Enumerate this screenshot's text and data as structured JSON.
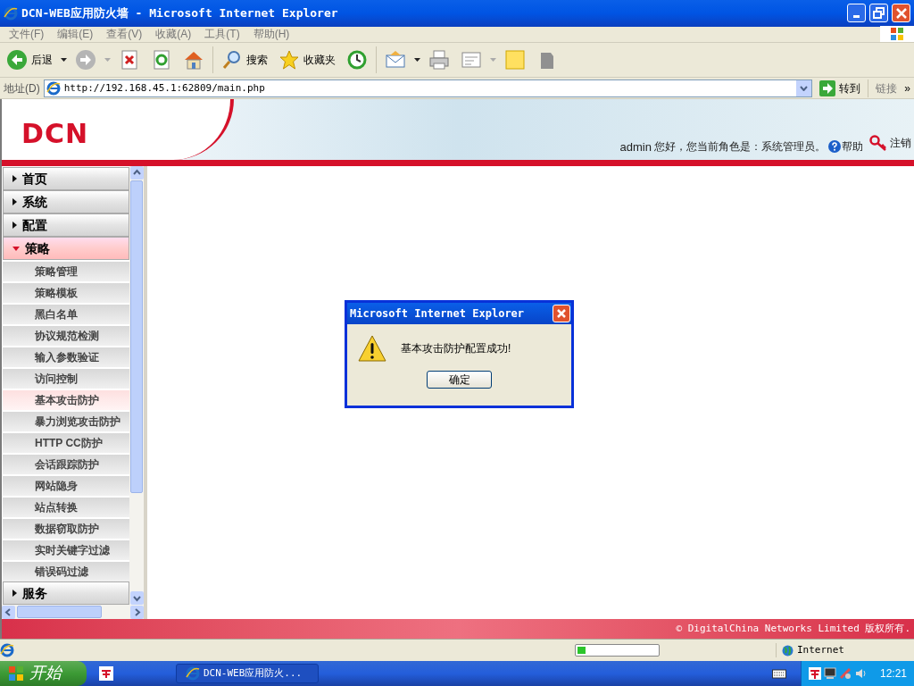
{
  "window": {
    "title": "DCN-WEB应用防火墙 - Microsoft Internet Explorer"
  },
  "menu_bar": [
    "文件(F)",
    "编辑(E)",
    "查看(V)",
    "收藏(A)",
    "工具(T)",
    "帮助(H)"
  ],
  "toolbar": [
    {
      "kind": "back",
      "label": "后退"
    },
    {
      "kind": "forward"
    },
    {
      "kind": "stop"
    },
    {
      "kind": "refresh"
    },
    {
      "kind": "home"
    },
    {
      "kind": "search",
      "label": "搜索"
    },
    {
      "kind": "favorites",
      "label": "收藏夹"
    },
    {
      "kind": "history"
    },
    {
      "kind": "mail"
    },
    {
      "kind": "print"
    },
    {
      "kind": "edit"
    },
    {
      "kind": "note"
    },
    {
      "kind": "messenger"
    }
  ],
  "address_bar": {
    "label": "地址(D)",
    "value": "http://192.168.45.1:62809/main.php",
    "go": "转到",
    "links": "链接",
    "more": "»"
  },
  "header": {
    "logo": "DCN",
    "user": "admin",
    "greeting": "您好，您当前角色是：系统管理员。",
    "help": "帮助",
    "logout": "注销"
  },
  "sidebar": {
    "items": [
      {
        "label": "首页",
        "expanded": false
      },
      {
        "label": "系统",
        "expanded": false
      },
      {
        "label": "配置",
        "expanded": false
      },
      {
        "label": "策略",
        "expanded": true,
        "children": [
          {
            "label": "策略管理",
            "selected": false
          },
          {
            "label": "策略模板",
            "selected": false
          },
          {
            "label": "黑白名单",
            "selected": false
          },
          {
            "label": "协议规范检测",
            "selected": false
          },
          {
            "label": "输入参数验证",
            "selected": false
          },
          {
            "label": "访问控制",
            "selected": false
          },
          {
            "label": "基本攻击防护",
            "selected": true
          },
          {
            "label": "暴力浏览攻击防护",
            "selected": false
          },
          {
            "label": "HTTP CC防护",
            "selected": false
          },
          {
            "label": "会话跟踪防护",
            "selected": false
          },
          {
            "label": "网站隐身",
            "selected": false
          },
          {
            "label": "站点转换",
            "selected": false
          },
          {
            "label": "数据窃取防护",
            "selected": false
          },
          {
            "label": "实时关键字过滤",
            "selected": false
          },
          {
            "label": "错误码过滤",
            "selected": false
          }
        ]
      },
      {
        "label": "服务",
        "expanded": false
      }
    ]
  },
  "dialog": {
    "title": "Microsoft Internet Explorer",
    "message": "基本攻击防护配置成功!",
    "ok": "确定"
  },
  "footer": {
    "copyright": "© DigitalChina Networks Limited 版权所有."
  },
  "status_bar": {
    "progress": {
      "level": 0.1
    },
    "zone": "Internet"
  },
  "taskbar": {
    "start": "开始",
    "tasks": [
      "DCN-WEB应用防火..."
    ],
    "clock": "12:21"
  }
}
